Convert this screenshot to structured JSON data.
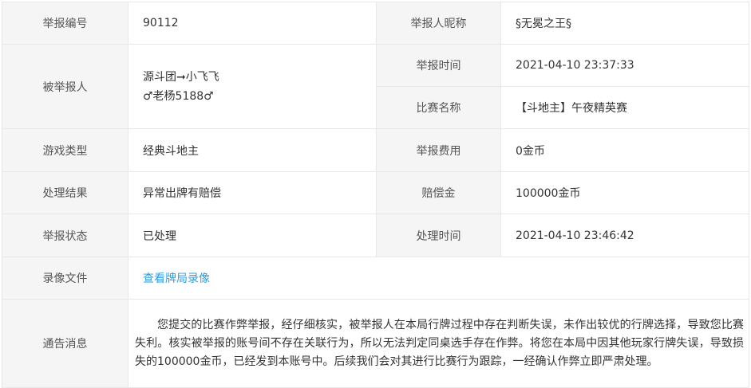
{
  "rows": {
    "report_id": {
      "label": "举报编号",
      "value": "90112"
    },
    "reporter_nick": {
      "label": "举报人昵称",
      "value": "§无冕之王§"
    },
    "reported": {
      "label": "被举报人",
      "line1": "源斗团➞小飞飞",
      "line2": "♂老杨5188♂"
    },
    "report_time": {
      "label": "举报时间",
      "value": "2021-04-10 23:37:33"
    },
    "match_name": {
      "label": "比赛名称",
      "value": "【斗地主】午夜精英赛"
    },
    "game_type": {
      "label": "游戏类型",
      "value": "经典斗地主"
    },
    "report_fee": {
      "label": "举报费用",
      "value": "0金币"
    },
    "result": {
      "label": "处理结果",
      "value": "异常出牌有赔偿"
    },
    "compensation": {
      "label": "赔偿金",
      "value": "100000金币"
    },
    "status": {
      "label": "举报状态",
      "value": "已处理"
    },
    "process_time": {
      "label": "处理时间",
      "value": "2021-04-10 23:46:42"
    },
    "recording": {
      "label": "录像文件",
      "link_text": "查看牌局录像"
    },
    "notice": {
      "label": "通告消息",
      "text": "您提交的比赛作弊举报，经仔细核实，被举报人在本局行牌过程中存在判断失误，未作出较优的行牌选择，导致您比赛失利。核实被举报的账号间不存在关联行为，所以无法判定同桌选手存在作弊。将您在本局中因其他玩家行牌失误，导致损失的100000金币，已经发到本账号中。后续我们会对其进行比赛行为跟踪，一经确认作弊立即严肃处理。"
    }
  },
  "colors": {
    "label_bg": "#f5f5f5",
    "border": "#e8e8e8",
    "link": "#2f9de0",
    "text": "#333333"
  }
}
